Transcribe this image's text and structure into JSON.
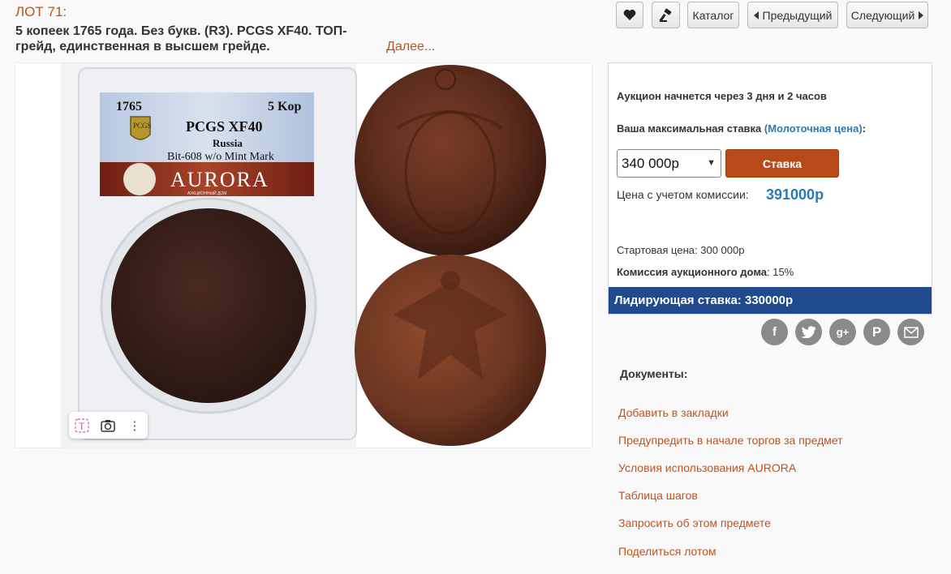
{
  "lot": {
    "number": "ЛОТ 71:",
    "title": "5 копеек 1765 года. Без букв. (R3). PCGS XF40. ТОП-грейд, единственная в высшем грейде.",
    "more": "Далее..."
  },
  "nav": {
    "catalog": "Каталог",
    "previous": "Предыдущий",
    "next": "Следующий"
  },
  "slab": {
    "year": "1765",
    "denomination": "5 Kop",
    "grade": "PCGS XF40",
    "country": "Russia",
    "variety": "Bit-608 w/o Mint Mark",
    "brand": "AURORA",
    "brand_sub": "АУКЦИОННЫЙ ДОМ",
    "logo": "PCGS"
  },
  "bid": {
    "start_notice": "Аукцион начнется через 3 дня и 2 часов",
    "max_bid_label": "Ваша максимальная ставка",
    "max_bid_hint": "(Молоточная цена)",
    "max_bid_colon": ":",
    "selected_amount": "340 000р",
    "bid_button": "Ставка",
    "commission_label": "Цена с учетом комиссии:",
    "commission_price": "391000р",
    "start_price_label": "Стартовая цена:",
    "start_price": "300 000р",
    "house_commission_label": "Комиссия аукционного дома",
    "house_commission": ": 15%",
    "leading_bid": "Лидирующая ставка: 330000р"
  },
  "documents": {
    "title": "Документы:",
    "links": [
      "Добавить в закладки",
      "Предупредить в начале торгов за предмет",
      "Условия использования AURORA",
      "Таблица шагов",
      "Запросить об этом предмете",
      "Поделиться лотом"
    ]
  },
  "colors": {
    "accent": "#c0521e",
    "bid_button": "#b84a1a",
    "leading_bar": "#1f4a8c",
    "link_blue": "#2a7ab5"
  },
  "icons": [
    "heart-icon",
    "auction-hammer-icon",
    "facebook-icon",
    "twitter-icon",
    "google-plus-icon",
    "pinterest-icon",
    "email-icon",
    "text-select-icon",
    "camera-icon",
    "more-vert-icon"
  ]
}
